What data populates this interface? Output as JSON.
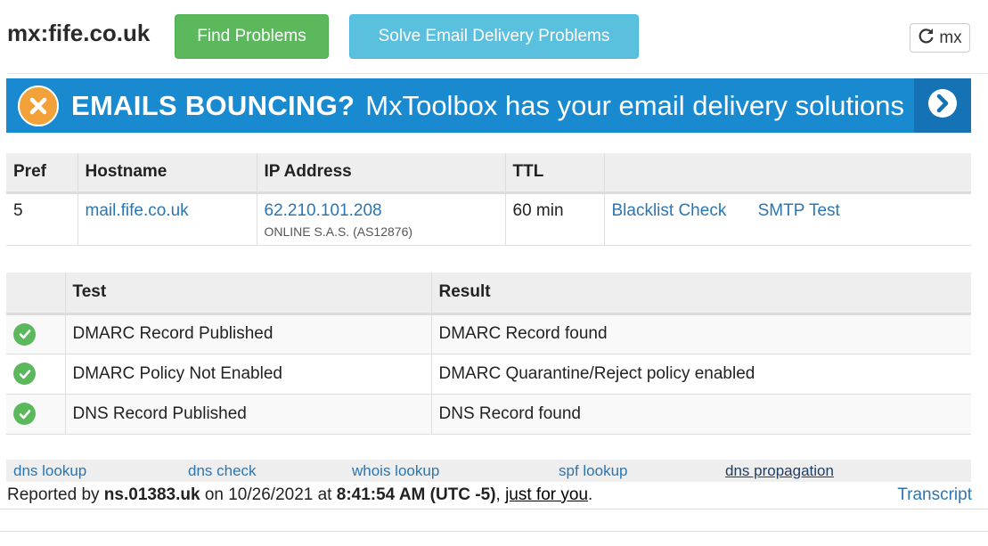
{
  "header": {
    "title": "mx:fife.co.uk",
    "find_problems": "Find Problems",
    "solve_delivery": "Solve Email Delivery Problems",
    "refresh_label": "mx"
  },
  "banner": {
    "headline": "EMAILS BOUNCING?",
    "tagline": "MxToolbox has your email delivery solutions"
  },
  "mx_table": {
    "headers": [
      "Pref",
      "Hostname",
      "IP Address",
      "TTL",
      ""
    ],
    "rows": [
      {
        "pref": "5",
        "hostname": "mail.fife.co.uk",
        "ip": "62.210.101.208",
        "asn": "ONLINE S.A.S. (AS12876)",
        "ttl": "60 min",
        "blacklist": "Blacklist Check",
        "smtp": "SMTP Test"
      }
    ]
  },
  "test_table": {
    "headers": [
      "",
      "Test",
      "Result"
    ],
    "rows": [
      {
        "test": "DMARC Record Published",
        "result": "DMARC Record found"
      },
      {
        "test": "DMARC Policy Not Enabled",
        "result": "DMARC Quarantine/Reject policy enabled"
      },
      {
        "test": "DNS Record Published",
        "result": "DNS Record found"
      }
    ]
  },
  "footer": {
    "links": [
      "dns lookup",
      "dns check",
      "whois lookup",
      "spf lookup",
      "dns propagation"
    ],
    "reported_prefix": "Reported by",
    "reporter": "ns.01383.uk",
    "on": "on 10/26/2021 at",
    "time": "8:41:54 AM (UTC -5)",
    "comma": ",",
    "just_for_you": "just for you",
    "period": ".",
    "transcript": "Transcript"
  },
  "colors": {
    "green_button": "#5cb85c",
    "blue_button": "#5bc0de",
    "banner_blue": "#1a8ad0",
    "link": "#2a76b4"
  },
  "icons": {
    "refresh": "refresh-icon",
    "banner_x": "x-circle-icon",
    "banner_arrow": "chevron-right-circle-icon",
    "status": "check-circle-icon"
  }
}
